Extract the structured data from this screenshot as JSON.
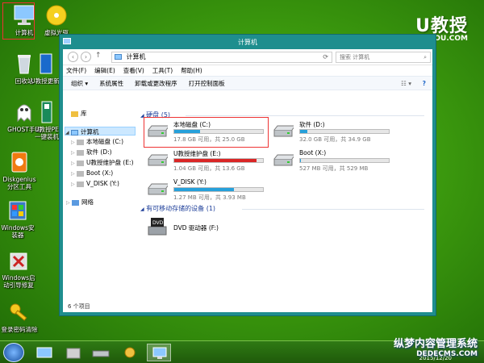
{
  "desktop": {
    "icons": [
      {
        "label": "计算机"
      },
      {
        "label": "虚拟光驱"
      },
      {
        "label": "回收站"
      },
      {
        "label": "U教授更新"
      },
      {
        "label": "GHOST手动"
      },
      {
        "label": "U教授PE一键装机"
      },
      {
        "label": "Diskgenius分区工具"
      },
      {
        "label": "Windows安装器"
      },
      {
        "label": "Windows启动引导修复"
      },
      {
        "label": "登录密码清除"
      }
    ]
  },
  "brand": {
    "name": "U教授",
    "site": "OU.COM"
  },
  "window": {
    "title": "计算机",
    "address": "计算机",
    "search_placeholder": "搜索 计算机",
    "menu": [
      "文件(F)",
      "编辑(E)",
      "查看(V)",
      "工具(T)",
      "帮助(H)"
    ],
    "toolbar": [
      "组织 ▾",
      "系统属性",
      "卸载或更改程序",
      "打开控制面板"
    ],
    "nav": {
      "library": "库",
      "computer": "计算机",
      "drives": [
        "本地磁盘 (C:)",
        "软件 (D:)",
        "U教授维护盘 (E:)",
        "Boot (X:)",
        "V_DISK (Y:)"
      ],
      "network": "网络"
    },
    "groups": {
      "hdd": "硬盘 (5)",
      "removable": "有可移动存储的设备 (1)"
    },
    "drives": [
      {
        "name": "本地磁盘 (C:)",
        "size": "17.8 GB 可用，共 25.0 GB",
        "used": 0.288
      },
      {
        "name": "软件 (D:)",
        "size": "32.0 GB 可用，共 34.9 GB",
        "used": 0.083
      },
      {
        "name": "U教授维护盘 (E:)",
        "size": "1.04 GB 可用，共 13.6 GB",
        "used": 0.924
      },
      {
        "name": "Boot (X:)",
        "size": "527 MB 可用，共 529 MB",
        "used": 0.004
      },
      {
        "name": "V_DISK (Y:)",
        "size": "1.27 MB 可用，共 3.93 MB",
        "used": 0.677
      }
    ],
    "dvd": {
      "name": "DVD 驱动器 (F:)",
      "badge": "DVD"
    },
    "status": "6 个项目"
  },
  "taskbar": {
    "clock": "2015/12/20"
  },
  "watermark": {
    "line1": "纵梦内容管理系统",
    "line2": "DEDECMS.COM"
  },
  "colors": {
    "accent": "#26a0da",
    "warning": "#da2626",
    "window_frame": "#1e8e8e",
    "highlight": "#e33333"
  }
}
